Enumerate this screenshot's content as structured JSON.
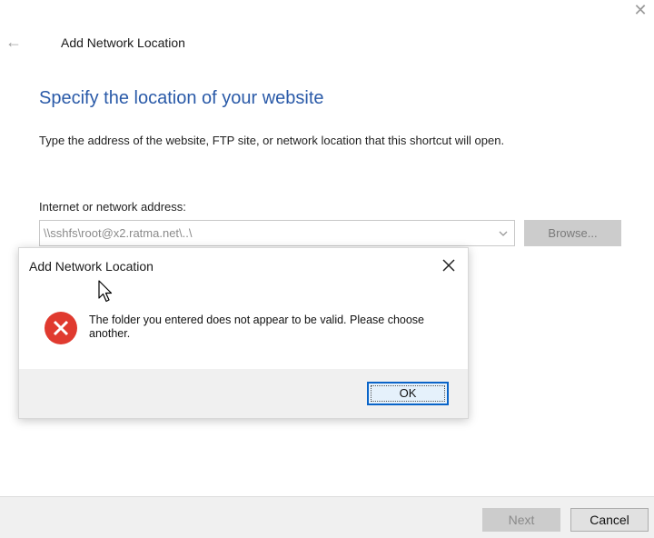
{
  "wizard": {
    "title": "Add Network Location",
    "heading": "Specify the location of your website",
    "instructions": "Type the address of the website, FTP site, or network location that this shortcut will open.",
    "address_label": "Internet or network address:",
    "address_value": "\\\\sshfs\\root@x2.ratma.net\\..\\",
    "browse_label": "Browse...",
    "next_label": "Next",
    "cancel_label": "Cancel"
  },
  "dialog": {
    "title": "Add Network Location",
    "message": "The folder you entered does not appear to be valid.  Please choose another.",
    "ok_label": "OK"
  },
  "icons": {
    "window_close": "close-icon",
    "back": "back-arrow-icon",
    "combo": "chevron-down-icon",
    "dialog_close": "close-icon",
    "error": "error-icon",
    "cursor": "mouse-pointer-icon"
  },
  "colors": {
    "heading": "#2a5aa8",
    "error": "#e03a2f",
    "focus_border": "#0a64c8",
    "disabled_button": "#cccccc"
  }
}
